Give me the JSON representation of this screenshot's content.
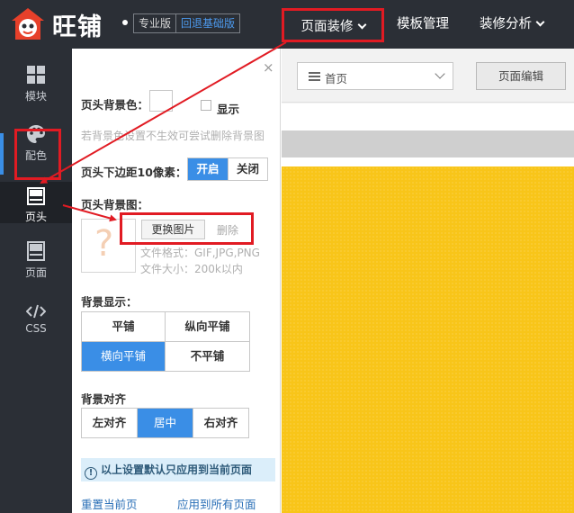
{
  "header": {
    "brand": "旺铺",
    "edition": "专业版",
    "rollback": "回退基础版",
    "nav": [
      {
        "label": "页面装修"
      },
      {
        "label": "模板管理"
      },
      {
        "label": "装修分析"
      }
    ]
  },
  "sidebar": {
    "items": [
      {
        "label": "模块",
        "icon": "grid-icon"
      },
      {
        "label": "配色",
        "icon": "palette-icon"
      },
      {
        "label": "页头",
        "icon": "header-icon"
      },
      {
        "label": "页面",
        "icon": "page-icon"
      },
      {
        "label": "CSS",
        "icon": "code-icon"
      }
    ],
    "active_index": 2
  },
  "panel": {
    "close": "×",
    "bg_color_label": "页头背景色：",
    "show_label": "显示",
    "hint": "若背景色设置不生效可尝试删除背景图",
    "margin_label": "页头下边距10像素：",
    "margin_on": "开启",
    "margin_off": "关闭",
    "bg_image_label": "页头背景图：",
    "placeholder": "?",
    "change_image": "更换图片",
    "delete": "删除",
    "file_format": "文件格式：GIF,JPG,PNG",
    "file_size": "文件大小：200k以内",
    "bg_display_label": "背景显示：",
    "display_options": [
      "平铺",
      "纵向平铺",
      "横向平铺",
      "不平铺"
    ],
    "display_selected": "横向平铺",
    "bg_align_label": "背景对齐",
    "align_options": [
      "左对齐",
      "居中",
      "右对齐"
    ],
    "align_selected": "居中",
    "notice": "以上设置默认只应用到当前页面",
    "reset_link": "重置当前页",
    "apply_all_link": "应用到所有页面"
  },
  "canvas": {
    "page_select": "首页",
    "edit_button": "页面编辑"
  },
  "colors": {
    "topbar": "#2b2f36",
    "accent": "#3a8ee6",
    "highlight": "#e11b23",
    "canvas_banner": "#f8c519"
  }
}
